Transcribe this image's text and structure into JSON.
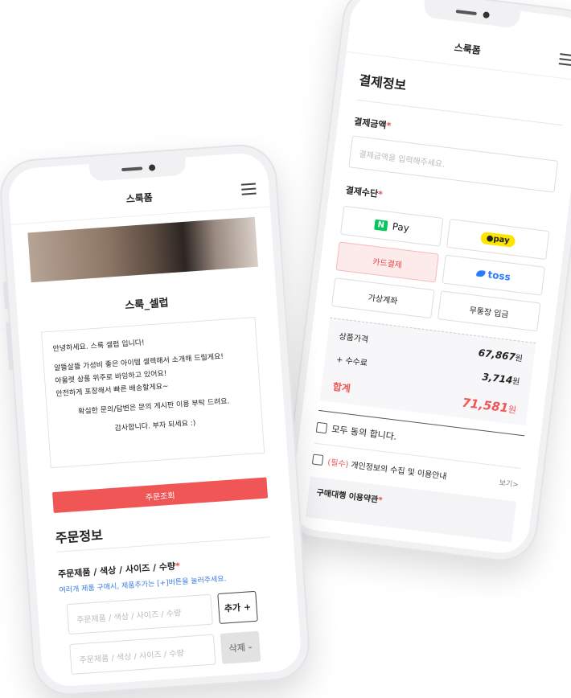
{
  "left_phone": {
    "app_title": "스룩폼",
    "shop_name": "스룩_셀럽",
    "intro_lines": [
      "안녕하세요. 스룩 셀럽 입니다!",
      "",
      "알뜰살뜰 가성비 좋은 아이템 셀렉해서 소개해 드릴게요!",
      "아울렛 상품 위주로 바잉하고 있어요!",
      "안전하게 포장해서 빠른 배송할게요~",
      "",
      "확실한 문의/답변은 문의 게시판 이용 부탁 드려요.",
      "",
      "감사합니다. 부자 되세요 :)"
    ],
    "order_lookup_button": "주문조회",
    "order_info_title": "주문정보",
    "order_field_label": "주문제품 / 색상 / 사이즈 / 수량",
    "order_field_hint": "여러개 제품 구매시, 제품추가는 [+]버튼을 눌러주세요.",
    "order_input_placeholder": "주문제품 / 색상 / 사이즈 / 수량",
    "add_button": "추가 +",
    "delete_button": "삭제 -"
  },
  "right_phone": {
    "app_title": "스룩폼",
    "payment_title": "결제정보",
    "amount_label": "결제금액",
    "amount_placeholder": "결제금액을 입력해주세요.",
    "method_label": "결제수단",
    "methods": {
      "naverpay_n": "N",
      "naverpay_text": "Pay",
      "kakaopay": "●pay",
      "card": "카드결제",
      "toss": "toss",
      "virtual_account": "가상계좌",
      "bank_transfer": "무통장 입금"
    },
    "summary": {
      "product_price_label": "상품가격",
      "product_price_value": "67,867",
      "fee_label": "+ 수수료",
      "fee_value": "3,714",
      "total_label": "합계",
      "total_value": "71,581",
      "currency": "원"
    },
    "agree_all": "모두 동의 합니다.",
    "privacy_required": "(필수)",
    "privacy_text": "개인정보의 수집 및 이용안내",
    "view_link": "보기>",
    "terms_label": "구매대행 이용약관"
  },
  "colors": {
    "accent_red": "#f05656",
    "link_blue": "#3b7ddd",
    "naver_green": "#03c75a",
    "kakao_yellow": "#fee500",
    "toss_blue": "#2d7bff"
  }
}
